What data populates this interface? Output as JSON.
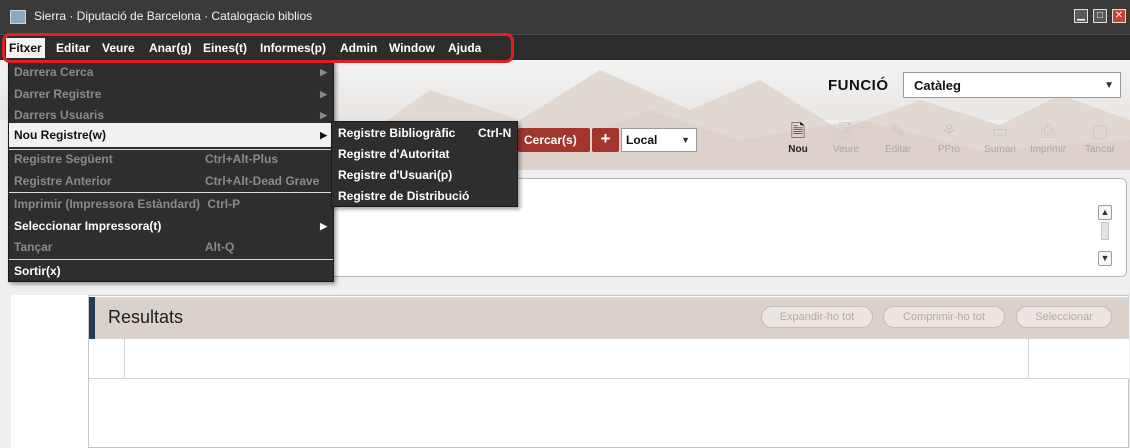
{
  "window": {
    "title": "Sierra · Diputació de Barcelona · Catalogacio biblios",
    "controls": [
      "minimize-icon",
      "maximize-icon",
      "close-icon"
    ]
  },
  "menubar": {
    "items": [
      {
        "label": "Fitxer",
        "mnemonic": "F"
      },
      {
        "label": "Editar",
        "mnemonic": "E"
      },
      {
        "label": "Veure",
        "mnemonic": "V"
      },
      {
        "label": "Anar(g)",
        "mnemonic": "g"
      },
      {
        "label": "Eines(t)",
        "mnemonic": "t"
      },
      {
        "label": "Informes(p)",
        "mnemonic": "p"
      },
      {
        "label": "Admin",
        "mnemonic": "A"
      },
      {
        "label": "Window",
        "mnemonic": "i"
      },
      {
        "label": "Ajuda",
        "mnemonic": "j"
      }
    ],
    "highlight_color": "#e02020"
  },
  "fitxer_menu": {
    "items": [
      {
        "label": "Darrera Cerca",
        "shortcut": "",
        "submenu": true,
        "enabled": false
      },
      {
        "label": "Darrer Registre",
        "shortcut": "",
        "submenu": true,
        "enabled": false
      },
      {
        "label": "Darrers Usuaris",
        "shortcut": "",
        "submenu": true,
        "enabled": false
      },
      {
        "label": "Nou Registre(w)",
        "shortcut": "",
        "submenu": true,
        "enabled": true,
        "selected": true
      },
      {
        "label": "Registre Següent",
        "shortcut": "Ctrl+Alt-Plus",
        "submenu": false,
        "enabled": false
      },
      {
        "label": "Registre Anterior",
        "shortcut": "Ctrl+Alt-Dead Grave",
        "submenu": false,
        "enabled": false
      },
      {
        "label": "Imprimir (Impressora Estàndard)",
        "shortcut": "Ctrl-P",
        "submenu": false,
        "enabled": false
      },
      {
        "label": "Seleccionar Impressora(t)",
        "shortcut": "",
        "submenu": true,
        "enabled": true
      },
      {
        "label": "Tançar",
        "shortcut": "Alt-Q",
        "submenu": false,
        "enabled": false
      },
      {
        "label": "Sortir(x)",
        "shortcut": "",
        "submenu": false,
        "enabled": true
      }
    ]
  },
  "nou_registre_submenu": {
    "items": [
      {
        "label": "Registre Bibliogràfic",
        "shortcut": "Ctrl-N"
      },
      {
        "label": "Registre d'Autoritat",
        "shortcut": ""
      },
      {
        "label": "Registre d'Usuari(p)",
        "shortcut": ""
      },
      {
        "label": "Registre de Distribució",
        "shortcut": ""
      }
    ]
  },
  "funcio": {
    "label": "FUNCIÓ",
    "value": "Catàleg"
  },
  "search": {
    "button_label": "Cercar(s)",
    "add_label": "+",
    "scope_value": "Local"
  },
  "toolbar": {
    "tools": [
      {
        "label": "Nou",
        "icon": "new-record-icon",
        "enabled": true
      },
      {
        "label": "Veure",
        "icon": "view-icon",
        "enabled": false
      },
      {
        "label": "Editar",
        "icon": "edit-icon",
        "enabled": false
      },
      {
        "label": "PPro",
        "icon": "ppro-icon",
        "enabled": false
      },
      {
        "label": "Sumari",
        "icon": "summary-icon",
        "enabled": false
      },
      {
        "label": "Imprimir",
        "icon": "print-icon",
        "enabled": false
      },
      {
        "label": "Tancar",
        "icon": "close-record-icon",
        "enabled": false
      }
    ]
  },
  "results": {
    "title": "Resultats",
    "buttons": [
      "Expandir-ho tot",
      "Comprimir-ho tot",
      "Seleccionar"
    ]
  },
  "colors": {
    "menubar_bg": "#2d2d2d",
    "accent_red": "#a2362f",
    "results_accent": "#263a55"
  }
}
